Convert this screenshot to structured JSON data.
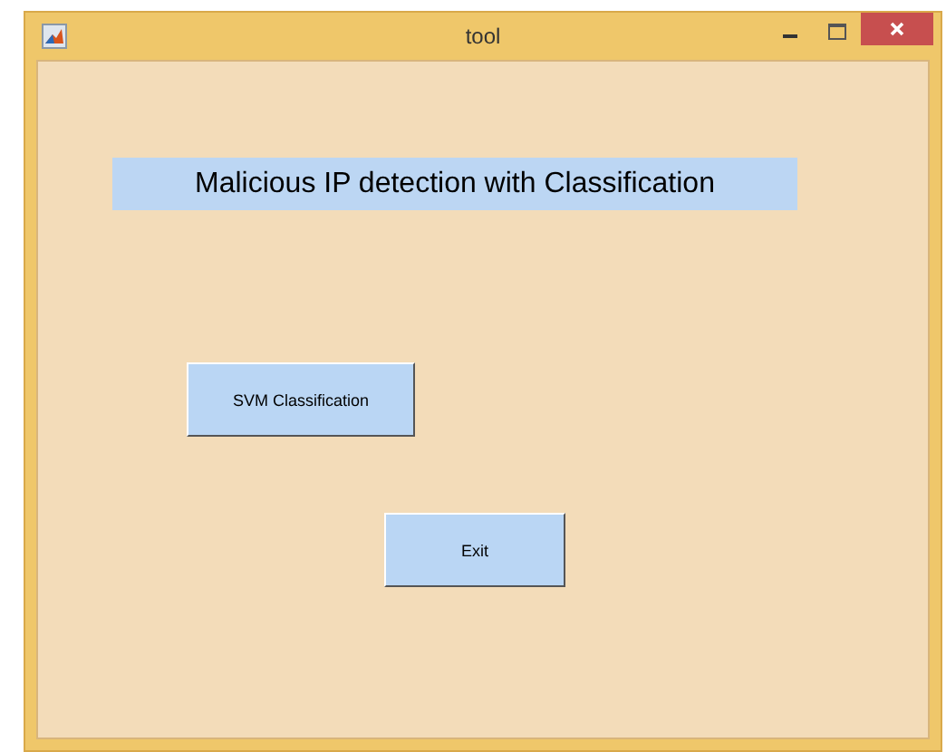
{
  "window": {
    "title": "tool"
  },
  "heading": "Malicious IP detection with Classification",
  "buttons": [
    {
      "label": "SVM Classification"
    },
    {
      "label": "Exit"
    }
  ]
}
